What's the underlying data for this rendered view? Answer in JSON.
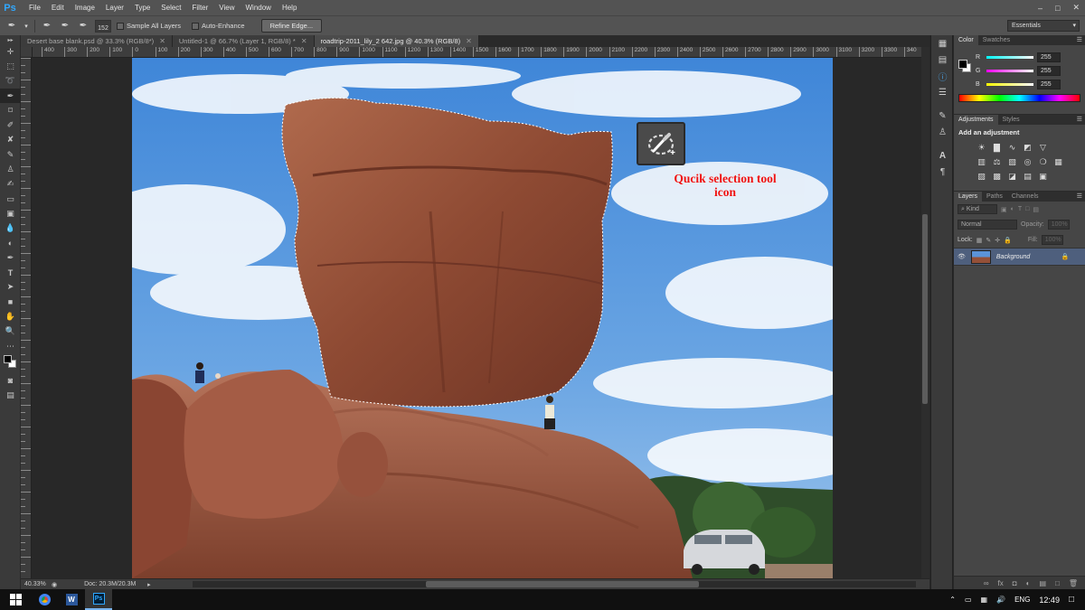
{
  "app": {
    "logo": "Ps"
  },
  "menu": [
    "File",
    "Edit",
    "Image",
    "Layer",
    "Type",
    "Select",
    "Filter",
    "View",
    "Window",
    "Help"
  ],
  "window_controls": {
    "minimize": "–",
    "maximize": "□",
    "close": "✕"
  },
  "options": {
    "brush_size": "152",
    "sample_all_layers": "Sample All Layers",
    "auto_enhance": "Auto-Enhance",
    "refine_edge": "Refine Edge...",
    "workspace": "Essentials"
  },
  "tabs": [
    {
      "label": "Desert base blank.psd @ 33.3% (RGB/8*)",
      "active": false
    },
    {
      "label": "Untitled-1 @ 66.7% (Layer 1, RGB/8) *",
      "active": false
    },
    {
      "label": "roadtrip-2011_lily_2 642.jpg @ 40.3% (RGB/8)",
      "active": true
    }
  ],
  "ruler_h": [
    "400",
    "300",
    "200",
    "100",
    "0",
    "100",
    "200",
    "300",
    "400",
    "500",
    "600",
    "700",
    "800",
    "900",
    "1000",
    "1100",
    "1200",
    "1300",
    "1400",
    "1500",
    "1600",
    "1700",
    "1800",
    "1900",
    "2000",
    "2100",
    "2200",
    "2300",
    "2400",
    "2500",
    "2600",
    "2700",
    "2800",
    "2900",
    "3000",
    "3100",
    "3200",
    "3300",
    "340"
  ],
  "annotation": {
    "line1": "Qucik selection tool",
    "line2": "icon",
    "icon": "quick-selection-brush-icon"
  },
  "status": {
    "zoom": "40.33%",
    "doc": "Doc: 20.3M/20.3M"
  },
  "color_panel": {
    "tabs": [
      "Color",
      "Swatches"
    ],
    "r_label": "R",
    "g_label": "G",
    "b_label": "B",
    "r": "255",
    "g": "255",
    "b": "255"
  },
  "adjustments_panel": {
    "tabs": [
      "Adjustments",
      "Styles"
    ],
    "title": "Add an adjustment"
  },
  "layers_panel": {
    "tabs": [
      "Layers",
      "Paths",
      "Channels"
    ],
    "kind": "Kind",
    "blend": "Normal",
    "opacity_label": "Opacity:",
    "opacity": "100%",
    "lock_label": "Lock:",
    "fill_label": "Fill:",
    "fill": "100%",
    "layer_name": "Background"
  },
  "taskbar": {
    "lang": "ENG",
    "time": "12:49"
  }
}
